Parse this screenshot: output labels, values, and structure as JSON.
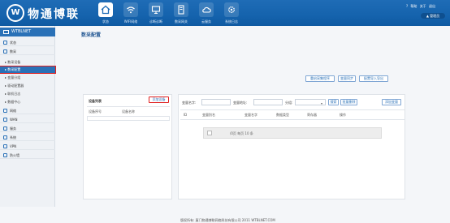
{
  "header": {
    "brand": "物通博联",
    "logo_text": "W",
    "nav": [
      {
        "label": "状态",
        "icon": "home-icon"
      },
      {
        "label": "WIFI网络",
        "icon": "wifi-icon"
      },
      {
        "label": "诊断诊断",
        "icon": "monitor-icon"
      },
      {
        "label": "数采网关",
        "icon": "gateway-icon"
      },
      {
        "label": "云服务",
        "icon": "cloud-icon"
      },
      {
        "label": "系统日志",
        "icon": "settings-icon"
      }
    ],
    "links": [
      "? 帮助",
      "关于",
      "退出"
    ],
    "user": "管理员"
  },
  "sidebar": {
    "title": "WTBLNET",
    "items": [
      {
        "label": "状态",
        "type": "group"
      },
      {
        "label": "数采",
        "type": "group"
      },
      {
        "label": "▸ 数采设备",
        "type": "sub"
      },
      {
        "label": "▸ 数采配置",
        "type": "sub",
        "active": true
      },
      {
        "label": "▸ 变量分组",
        "type": "sub"
      },
      {
        "label": "▸ 驱动配置器",
        "type": "sub"
      },
      {
        "label": "▸ 联机日志",
        "type": "sub"
      },
      {
        "label": "▸ 数据中心",
        "type": "sub"
      },
      {
        "label": "网络",
        "type": "group"
      },
      {
        "label": "WAN",
        "type": "group"
      },
      {
        "label": "服务",
        "type": "group"
      },
      {
        "label": "系统",
        "type": "group"
      },
      {
        "label": "VPN",
        "type": "group"
      },
      {
        "label": "防火墙",
        "type": "group"
      }
    ]
  },
  "page": {
    "title": "数采配置",
    "toolbar": [
      "重启采集程序",
      "变量同步",
      "配置导入导出"
    ]
  },
  "device_list": {
    "title": "设备列表",
    "add_button": "添加设备",
    "columns": [
      "设备序号",
      "设备名称"
    ]
  },
  "variables": {
    "filter_name_label": "变量名字:",
    "filter_addr_label": "变量地址:",
    "filter_group_label": "分组:",
    "search_button": "搜索",
    "batch_delete_button": "批量删除",
    "add_variable_button": "添加变量",
    "columns": [
      "ID",
      "变量别名",
      "变量名字",
      "数据类型",
      "寄存器",
      "操作"
    ],
    "pager": "/0页  每页 10 条"
  },
  "footer": "版权所有: 厦门物通博联网络科技有限公司  2011  WTBLNET.COM"
}
